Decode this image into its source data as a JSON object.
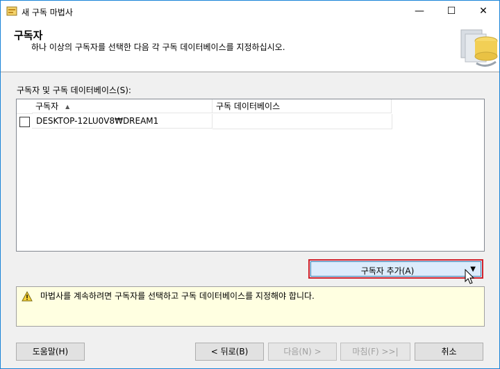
{
  "window": {
    "title": "새 구독 마법사",
    "controls": {
      "minimize": "—",
      "maximize": "☐",
      "close": "✕"
    }
  },
  "header": {
    "title": "구독자",
    "subtitle": "하나 이상의 구독자를 선택한 다음 각 구독 데이터베이스를 지정하십시오."
  },
  "subscribers": {
    "label": "구독자 및 구독 데이터베이스(S):",
    "columns": {
      "subscriber": "구독자",
      "database": "구독 데이터베이스"
    },
    "rows": [
      {
        "checked": false,
        "subscriber": "DESKTOP-12LU0V8₩DREAM1",
        "database": ""
      }
    ]
  },
  "add_button": {
    "label": "구독자 추가(A)",
    "caret": "▼"
  },
  "warning": {
    "icon": "warning-icon",
    "text": "마법사를 계속하려면 구독자를 선택하고 구독 데이터베이스를 지정해야 합니다."
  },
  "buttons": {
    "help": "도움말(H)",
    "back": "< 뒤로(B)",
    "next": "다음(N) >",
    "finish": "마침(F) >>|",
    "cancel": "취소"
  },
  "colors": {
    "accent_border": "#d0202a",
    "warning_bg": "#ffffe1",
    "window_border": "#1883d7"
  }
}
